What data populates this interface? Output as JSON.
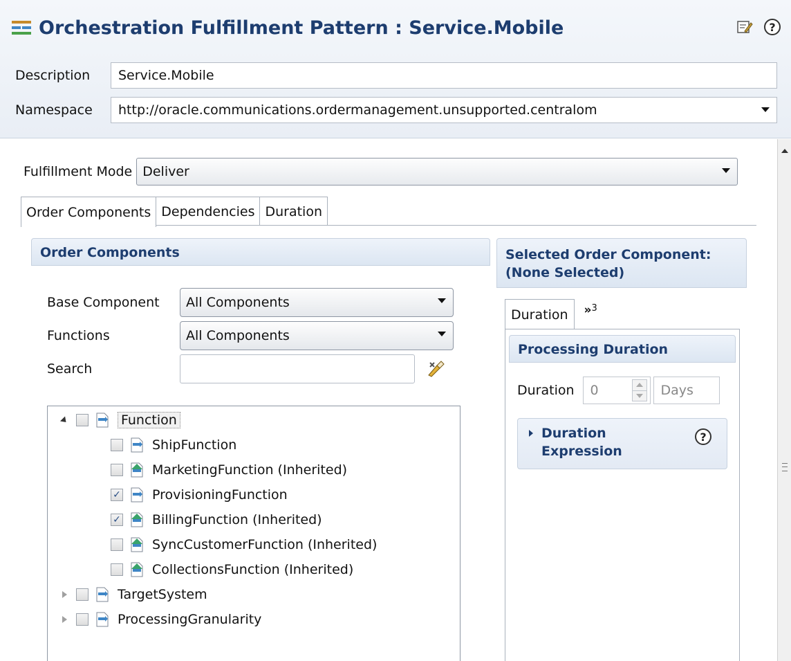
{
  "header": {
    "title": "Orchestration Fulfillment Pattern : Service.Mobile",
    "description_label": "Description",
    "description_value": "Service.Mobile",
    "namespace_label": "Namespace",
    "namespace_value": "http://oracle.communications.ordermanagement.unsupported.centralom"
  },
  "fulfillment_mode": {
    "label": "Fulfillment Mode",
    "value": "Deliver"
  },
  "tabs": [
    "Order Components",
    "Dependencies",
    "Duration"
  ],
  "order_components": {
    "heading": "Order Components",
    "base_component_label": "Base Component",
    "base_component_value": "All Components",
    "functions_label": "Functions",
    "functions_value": "All Components",
    "search_label": "Search",
    "search_value": ""
  },
  "tree": {
    "root": {
      "label": "Function",
      "checked": false,
      "expanded": true
    },
    "children": [
      {
        "label": "ShipFunction",
        "checked": false,
        "inherited": false
      },
      {
        "label": "MarketingFunction (Inherited)",
        "checked": false,
        "inherited": true
      },
      {
        "label": "ProvisioningFunction",
        "checked": true,
        "inherited": false
      },
      {
        "label": "BillingFunction (Inherited)",
        "checked": true,
        "inherited": true
      },
      {
        "label": "SyncCustomerFunction (Inherited)",
        "checked": false,
        "inherited": true
      },
      {
        "label": "CollectionsFunction (Inherited)",
        "checked": false,
        "inherited": true
      }
    ],
    "siblings": [
      {
        "label": "TargetSystem",
        "checked": false,
        "expanded": false
      },
      {
        "label": "ProcessingGranularity",
        "checked": false,
        "expanded": false
      }
    ]
  },
  "selected_component": {
    "heading_line1": "Selected Order Component:",
    "heading_line2": "(None Selected)",
    "tab_label": "Duration",
    "more_tabs_glyph": "»",
    "more_tabs_count": "3",
    "processing_duration_heading": "Processing Duration",
    "duration_label": "Duration",
    "duration_value": "0",
    "duration_unit": "Days",
    "expression_line1": "Duration",
    "expression_line2": "Expression"
  },
  "icons": {
    "help": "?",
    "check": "✓"
  },
  "colors": {
    "heading_text": "#1d3d6f",
    "panel_header_bg": "#dce6f2",
    "checkbox_mark": "#2b4f86"
  }
}
